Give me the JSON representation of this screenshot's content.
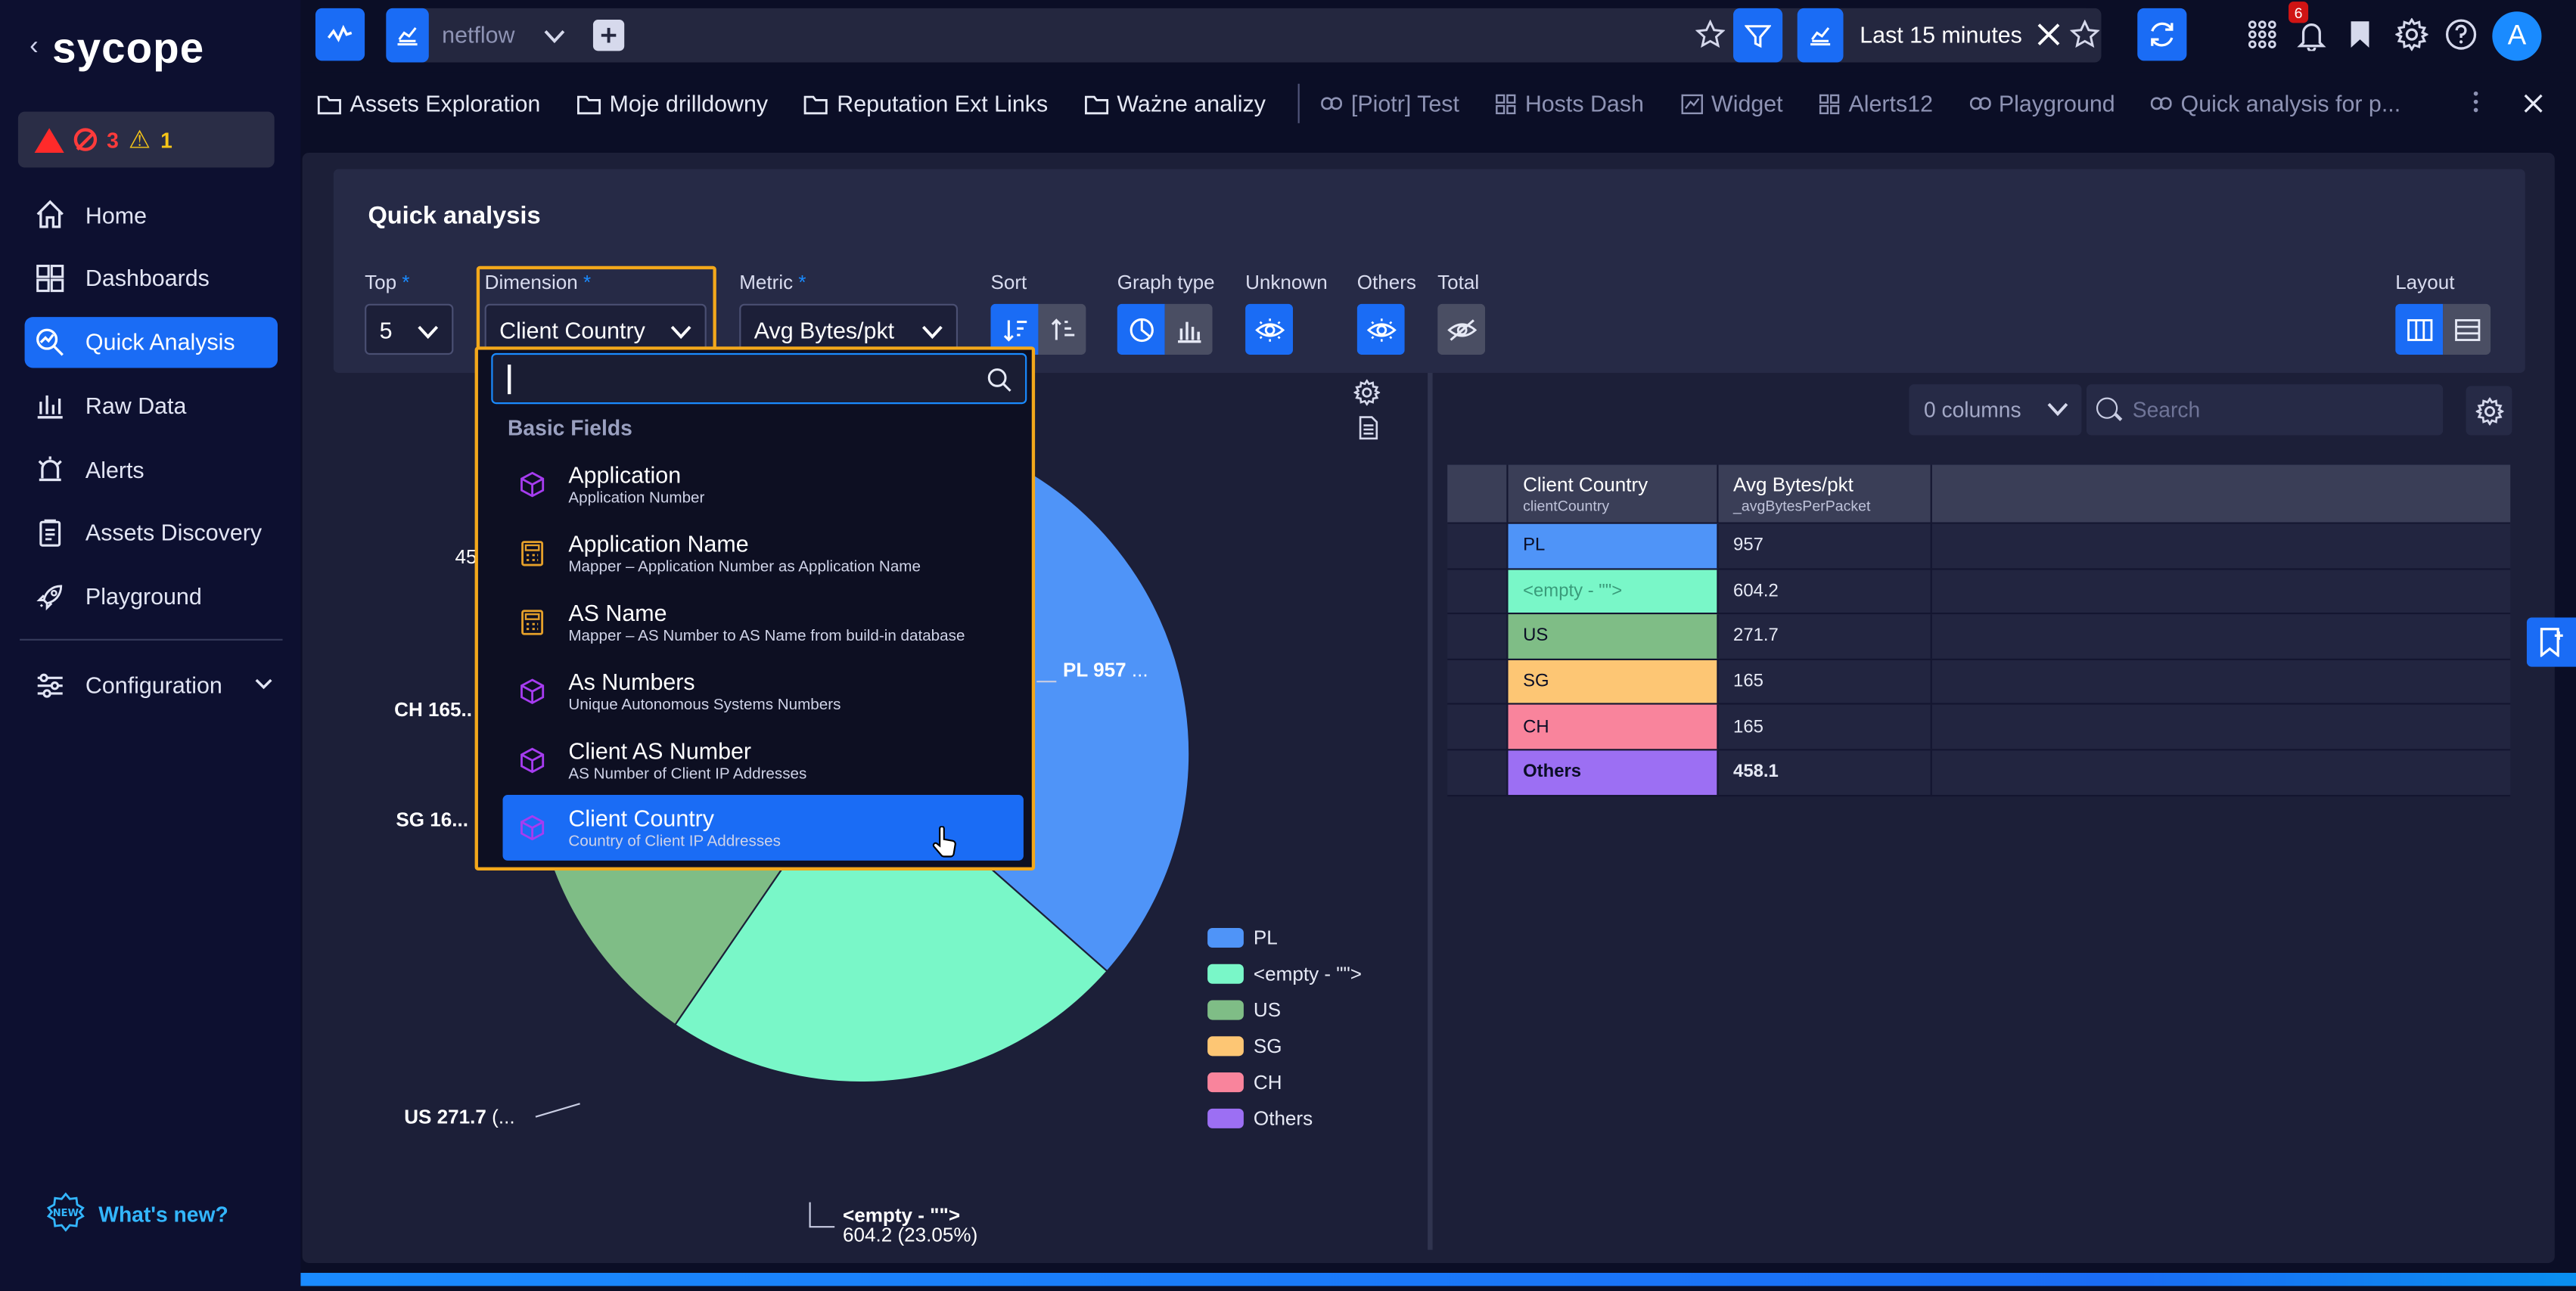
{
  "app": {
    "logo": "sycope"
  },
  "alerts": {
    "critical": "",
    "errors": "3",
    "warnings": "1"
  },
  "sidebar": {
    "items": [
      {
        "label": "Home"
      },
      {
        "label": "Dashboards"
      },
      {
        "label": "Quick Analysis"
      },
      {
        "label": "Raw Data"
      },
      {
        "label": "Alerts"
      },
      {
        "label": "Assets Discovery"
      },
      {
        "label": "Playground"
      }
    ],
    "configuration": "Configuration",
    "whats_new": "What's new?"
  },
  "topbar": {
    "source": "netflow",
    "time_range": "Last 15 minutes",
    "notification_count": "6",
    "avatar": "A"
  },
  "tabs": {
    "folders": [
      "Assets Exploration",
      "Moje drilldowny",
      "Reputation Ext Links",
      "Ważne analizy"
    ],
    "links": [
      "[Piotr] Test",
      "Hosts Dash",
      "Widget",
      "Alerts12",
      "Playground",
      "Quick analysis for p..."
    ]
  },
  "quick_analysis": {
    "title": "Quick analysis",
    "top_label": "Top",
    "top_value": "5",
    "dimension_label": "Dimension",
    "dimension_value": "Client Country",
    "metric_label": "Metric",
    "metric_value": "Avg Bytes/pkt",
    "sort_label": "Sort",
    "graph_type_label": "Graph type",
    "unknown_label": "Unknown",
    "others_label": "Others",
    "total_label": "Total",
    "layout_label": "Layout",
    "required_mark": "*"
  },
  "dropdown": {
    "search_value": "",
    "group": "Basic Fields",
    "items": [
      {
        "title": "Application",
        "subtitle": "Application Number",
        "icon": "cube-icon"
      },
      {
        "title": "Application Name",
        "subtitle": "Mapper – Application Number as Application Name",
        "icon": "calculator-icon"
      },
      {
        "title": "AS Name",
        "subtitle": "Mapper – AS Number to AS Name from build-in database",
        "icon": "calculator-icon"
      },
      {
        "title": "As Numbers",
        "subtitle": "Unique Autonomous Systems Numbers",
        "icon": "cube-icon"
      },
      {
        "title": "Client AS Number",
        "subtitle": "AS Number of Client IP Addresses",
        "icon": "cube-icon"
      },
      {
        "title": "Client Country",
        "subtitle": "Country of Client IP Addresses",
        "icon": "cube-icon"
      }
    ]
  },
  "chart_labels": {
    "pl": "PL 957",
    "pl_tail": "...",
    "ch": "CH 165..",
    "sg": "SG 16...",
    "us": "US 271.7",
    "us_tail": "(...",
    "others_partial": "45",
    "empty_name": "<empty - \"\">",
    "empty_value": "604.2",
    "empty_pct": "(23.05%)"
  },
  "chart_data": {
    "type": "pie",
    "categories": [
      "PL",
      "<empty - \"\">",
      "US",
      "SG",
      "CH",
      "Others"
    ],
    "values": [
      957,
      604.2,
      271.7,
      165,
      165,
      458.1
    ],
    "colors": [
      "#4f94f8",
      "#79f7c8",
      "#7fbd86",
      "#fdc674",
      "#f9849c",
      "#9c6ff3"
    ],
    "legend_position": "right"
  },
  "table": {
    "columns_selector": "0 columns",
    "search_placeholder": "Search",
    "headers": [
      {
        "title": "Client Country",
        "sub": "clientCountry"
      },
      {
        "title": "Avg Bytes/pkt",
        "sub": "_avgBytesPerPacket"
      }
    ],
    "rows": [
      {
        "country": "PL",
        "value": "957",
        "color": "#4f94f8",
        "text": "#0b0e26"
      },
      {
        "country": "<empty - \"\">",
        "value": "604.2",
        "color": "#79f7c8",
        "text": "#3a9b7a"
      },
      {
        "country": "US",
        "value": "271.7",
        "color": "#7fbd86",
        "text": "#0b0e26"
      },
      {
        "country": "SG",
        "value": "165",
        "color": "#fdc674",
        "text": "#0b0e26"
      },
      {
        "country": "CH",
        "value": "165",
        "color": "#f9849c",
        "text": "#0b0e26"
      },
      {
        "country": "Others",
        "value": "458.1",
        "color": "#9c6ff3",
        "text": "#0b0e26"
      }
    ]
  }
}
